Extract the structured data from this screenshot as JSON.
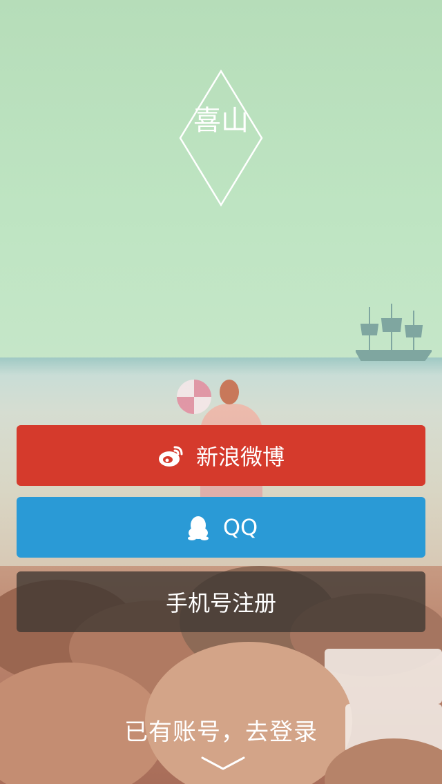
{
  "logo": {
    "text": "喜山"
  },
  "buttons": {
    "weibo_label": "新浪微博",
    "qq_label": "QQ",
    "phone_label": "手机号注册"
  },
  "login": {
    "label": "已有账号，去登录"
  },
  "icons": {
    "weibo": "weibo-icon",
    "qq": "qq-penguin-icon",
    "chevron": "chevron-down-icon"
  },
  "colors": {
    "weibo": "#d53a2c",
    "qq": "#2a9ad6",
    "phone": "#3d3732"
  }
}
